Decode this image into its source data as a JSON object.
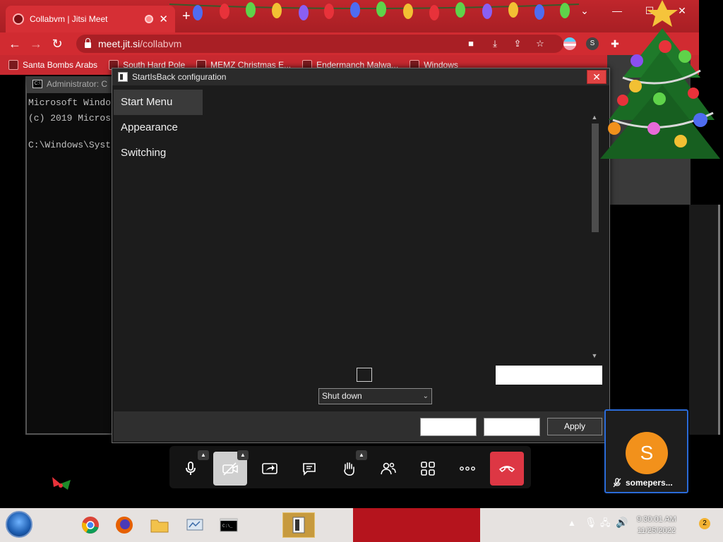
{
  "browser": {
    "tab_title": "Collabvm | Jitsi Meet",
    "new_tab_label": "+",
    "url_host": "meet.jit.si",
    "url_path": "/collabvm",
    "bookmarks": [
      {
        "label": "Santa Bombs Arabs"
      },
      {
        "label": "South Hard Pole"
      },
      {
        "label": "MEMZ Christmas E..."
      },
      {
        "label": "Endermanch Malwa..."
      },
      {
        "label": "Windows"
      }
    ],
    "accent_color": "#c0262c"
  },
  "cmd_window": {
    "title": "Administrator: C",
    "lines": [
      "Microsoft Windo",
      "(c) 2019 Micros",
      "",
      "C:\\Windows\\Syst"
    ]
  },
  "dialog": {
    "title": "StartIsBack configuration",
    "close_label": "✕",
    "nav": [
      {
        "label": "Start Menu",
        "selected": true
      },
      {
        "label": "Appearance",
        "selected": false
      },
      {
        "label": "Switching",
        "selected": false
      }
    ],
    "dropdown_value": "Shut down",
    "apply_label": "Apply"
  },
  "jitsi": {
    "participant_initial": "S",
    "participant_name": "somepers...",
    "avatar_color": "#f2911b",
    "hangup_color": "#dd3744",
    "tile_border_color": "#2a6bd8"
  },
  "taskbar": {
    "clock_time": "9:30:01 AM",
    "clock_date": "11/25/2022",
    "notification_count": "2"
  }
}
